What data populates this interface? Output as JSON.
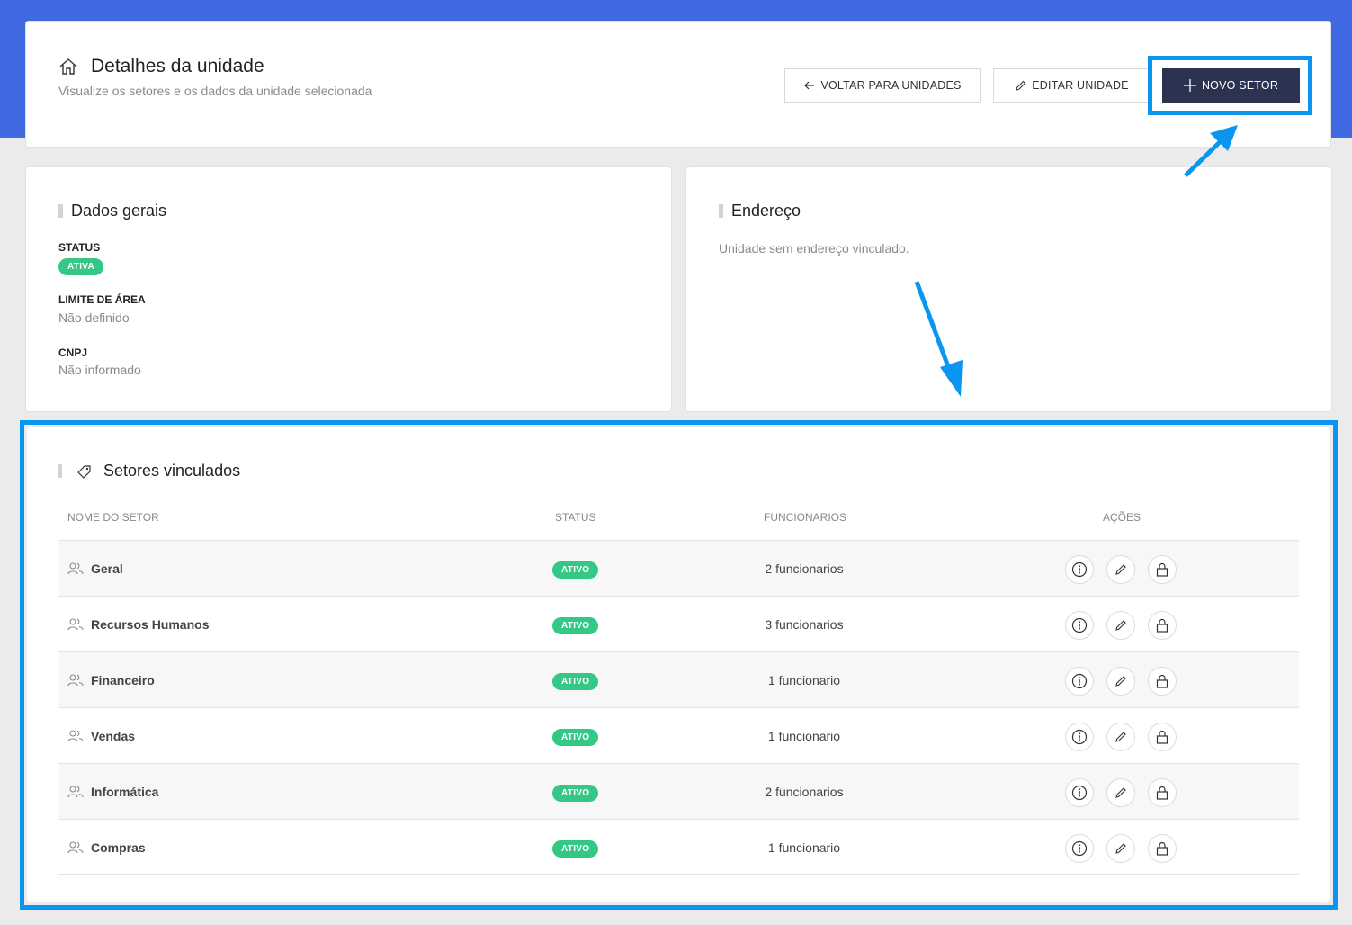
{
  "header": {
    "title": "Detalhes da unidade",
    "subtitle": "Visualize os setores e os dados da unidade selecionada",
    "back_label": "VOLTAR PARA UNIDADES",
    "edit_label": "EDITAR UNIDADE",
    "new_label": "NOVO SETOR"
  },
  "general": {
    "title": "Dados gerais",
    "status_label": "STATUS",
    "status_value": "ATIVA",
    "area_label": "LIMITE DE ÁREA",
    "area_value": "Não definido",
    "cnpj_label": "CNPJ",
    "cnpj_value": "Não informado"
  },
  "address": {
    "title": "Endereço",
    "empty": "Unidade sem endereço vinculado."
  },
  "sectors": {
    "title": "Setores vinculados",
    "columns": [
      "NOME DO SETOR",
      "STATUS",
      "FUNCIONARIOS",
      "AÇÕES"
    ],
    "rows": [
      {
        "name": "Geral",
        "status": "ATIVO",
        "employees": "2 funcionarios"
      },
      {
        "name": "Recursos Humanos",
        "status": "ATIVO",
        "employees": "3 funcionarios"
      },
      {
        "name": "Financeiro",
        "status": "ATIVO",
        "employees": "1 funcionario"
      },
      {
        "name": "Vendas",
        "status": "ATIVO",
        "employees": "1 funcionario"
      },
      {
        "name": "Informática",
        "status": "ATIVO",
        "employees": "2 funcionarios"
      },
      {
        "name": "Compras",
        "status": "ATIVO",
        "employees": "1 funcionario"
      }
    ]
  },
  "icons": {
    "home": "home-icon",
    "back": "arrow-left-icon",
    "edit": "pencil-icon",
    "plus": "plus-icon",
    "tag": "tag-icon",
    "users": "users-icon",
    "info": "info-icon",
    "lock": "lock-icon"
  },
  "colors": {
    "brand": "#4169e1",
    "primary_button": "#2b3350",
    "badge": "#34c785",
    "annotation": "#0a96f0"
  }
}
